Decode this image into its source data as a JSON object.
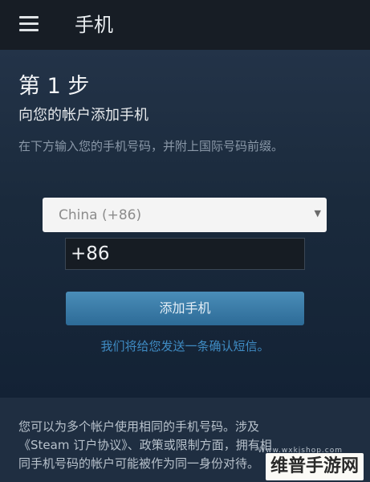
{
  "app_bar": {
    "title": "手机",
    "menu_icon": "hamburger-menu-icon"
  },
  "main": {
    "step_heading": "第 1 步",
    "step_subtitle": "向您的帐户添加手机",
    "instructions": "在下方输入您的手机号码，并附上国际号码前缀。",
    "country_select": {
      "selected": "China (+86)",
      "arrow_icon": "dropdown-arrow-icon"
    },
    "phone_input": {
      "value": "+86"
    },
    "add_phone_button": "添加手机",
    "sms_note": "我们将给您发送一条确认短信。"
  },
  "footer": {
    "lines": [
      "您可以为多个帐户使用相同的手机号码。涉及",
      "《Steam 订户协议》、政策或限制方面，拥有相",
      "同手机号码的帐户可能被作为同一身份对待。"
    ],
    "watermark": "维普手游网",
    "watermark_small": "Www.wxkjshop.com"
  },
  "colors": {
    "background": "#1b2838",
    "app_bar": "#171d25",
    "button": "#3a7cab",
    "link_text": "#3f8cc4",
    "muted_text": "#8a98a8"
  }
}
